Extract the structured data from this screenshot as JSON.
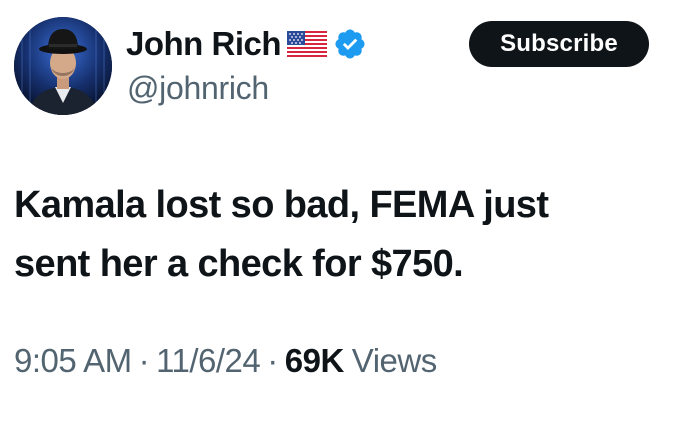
{
  "author": {
    "display_name": "John Rich",
    "handle": "@johnrich",
    "flag_icon": "us-flag-icon",
    "verified_icon": "verified-badge-icon",
    "verified_color": "#1d9bf0",
    "avatar_icon": "profile-photo"
  },
  "actions": {
    "subscribe_label": "Subscribe"
  },
  "tweet": {
    "lines": [
      "Kamala lost so bad, FEMA just",
      "sent her a check for $750."
    ]
  },
  "meta": {
    "time": "9:05 AM",
    "separator": "·",
    "date": "11/6/24",
    "views_count": "69K",
    "views_label": "Views"
  },
  "colors": {
    "text_primary": "#0f1419",
    "text_secondary": "#536471",
    "button_bg": "#0f1419",
    "button_text": "#ffffff"
  }
}
